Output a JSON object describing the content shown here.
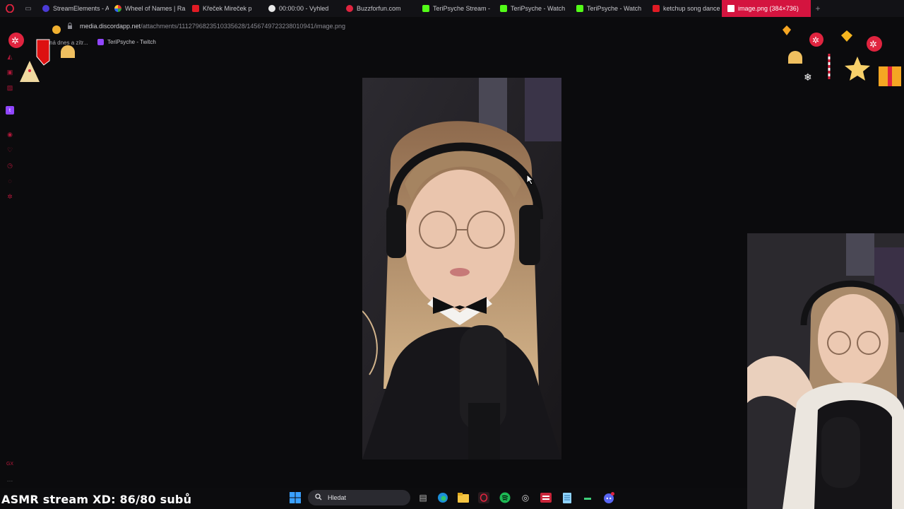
{
  "browser": {
    "tabs": [
      {
        "label": "StreamElements - Act",
        "favicon": "streamelements-icon",
        "color": "#4b3bd6"
      },
      {
        "label": "Wheel of Names | Ra",
        "favicon": "wheel-icon",
        "color": "#3aa13c"
      },
      {
        "label": "Křeček Mireček p",
        "favicon": "youtube-icon",
        "color": "#e01b24"
      },
      {
        "label": "00:00:00 - Vyhled",
        "favicon": "google-icon",
        "color": "#e8e8e8"
      },
      {
        "label": "Buzzforfun.com",
        "favicon": "buzz-icon",
        "color": "#e0243f"
      },
      {
        "label": "TeriPsyche Stream -",
        "favicon": "kick-icon",
        "color": "#53fc18"
      },
      {
        "label": "TeriPsyche - Watch",
        "favicon": "kick-icon",
        "color": "#53fc18"
      },
      {
        "label": "TeriPsyche - Watch",
        "favicon": "kick-icon",
        "color": "#53fc18"
      },
      {
        "label": "ketchup song dance",
        "favicon": "youtube-icon",
        "color": "#e01b24"
      },
      {
        "label": "image.png (384×736)",
        "favicon": "file-icon",
        "color": "#ffffff",
        "active": true
      }
    ],
    "address": {
      "host": "media.discordapp.net",
      "path": "/attachments/1112796823510335628/1456749723238010941/image.png"
    },
    "bookmarks": [
      {
        "label": "ná dnes a zítr..."
      },
      {
        "label": "TeriPsyche - Twitch"
      }
    ],
    "accent_color": "#d4143f"
  },
  "overlay": {
    "goal_text": "ASMR stream XD: 86/80 subů"
  },
  "taskbar": {
    "search_label": "Hledat"
  }
}
